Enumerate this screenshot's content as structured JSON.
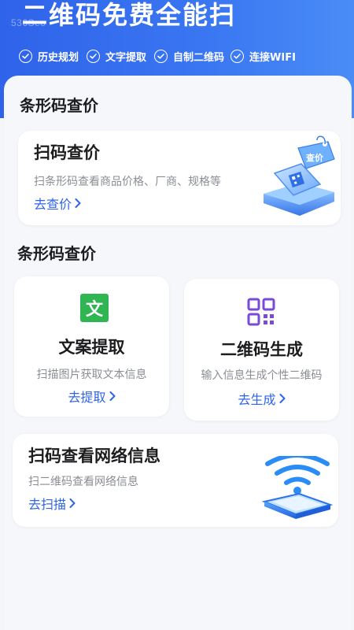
{
  "header": {
    "watermark": "536Seo",
    "title": "二维码免费全能扫",
    "features": [
      {
        "label": "历史规划",
        "icon": "check-circle-icon"
      },
      {
        "label": "文字提取",
        "icon": "check-circle-icon"
      },
      {
        "label": "自制二维码",
        "icon": "check-circle-icon"
      },
      {
        "label": "连接WIFI",
        "icon": "check-circle-icon"
      }
    ]
  },
  "section1": {
    "title": "条形码查价",
    "card": {
      "title": "扫码查价",
      "desc": "扫条形码查看商品价格、厂商、规格等",
      "link": "去查价",
      "tag": "查价"
    }
  },
  "section2": {
    "title": "条形码查价",
    "cards": [
      {
        "title": "文案提取",
        "desc": "扫描图片获取文本信息",
        "link": "去提取",
        "icon_text": "文"
      },
      {
        "title": "二维码生成",
        "desc": "输入信息生成个性二维码",
        "link": "去生成"
      }
    ],
    "wifi_card": {
      "title": "扫码查看网络信息",
      "desc": "扫二维码查看网络信息",
      "link": "去扫描"
    }
  },
  "colors": {
    "header_blue": "#3370ee",
    "link_blue": "#2f64e6",
    "text_icon_green": "#2fb552",
    "qr_icon_purple": "#7b4ad6"
  }
}
